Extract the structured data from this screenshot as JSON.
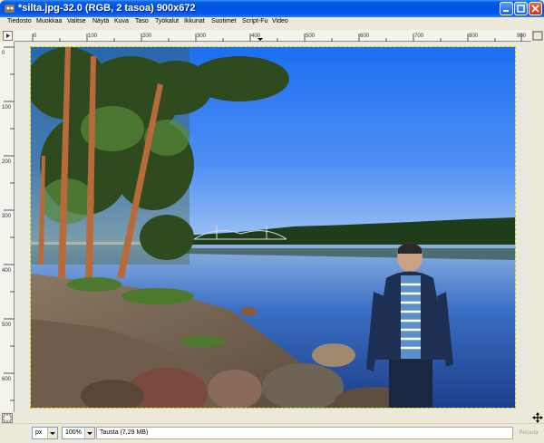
{
  "window": {
    "title": "*silta.jpg-32.0 (RGB, 2 tasoa) 900x672"
  },
  "menubar": {
    "items": [
      "Tiedosto",
      "Muokkaa",
      "Valitse",
      "Näytä",
      "Kuva",
      "Taso",
      "Työkalut",
      "Ikkunat",
      "Suotimet",
      "Script-Fu",
      "Video"
    ]
  },
  "rulers": {
    "horizontal_ticks": [
      "0",
      "100",
      "200",
      "300",
      "400",
      "500",
      "600",
      "700",
      "800",
      "900"
    ],
    "vertical_ticks": [
      "0",
      "100",
      "200",
      "300",
      "400",
      "500",
      "600"
    ]
  },
  "statusbar": {
    "unit": "px",
    "zoom": "100%",
    "status": "Tausta (7,29 MB)",
    "cancel_label": "Peruuta"
  },
  "colors": {
    "titlebar": "#0053e1",
    "window_bg": "#ece9d8",
    "canvas_bg": "#e9e8e1"
  }
}
